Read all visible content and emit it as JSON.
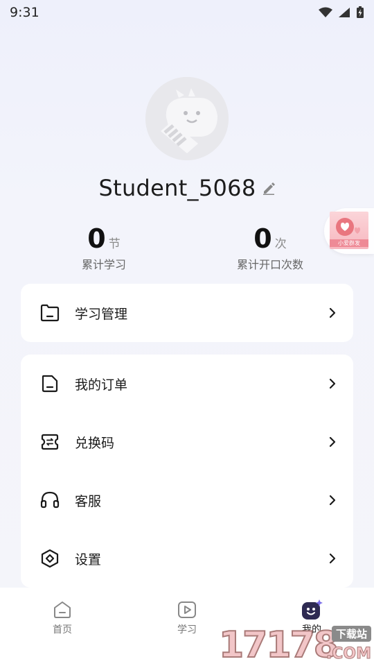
{
  "status_bar": {
    "time": "9:31"
  },
  "profile": {
    "username": "Student_5068"
  },
  "stats": [
    {
      "value": "0",
      "unit": "节",
      "label": "累计学习"
    },
    {
      "value": "0",
      "unit": "次",
      "label": "累计开口次数"
    }
  ],
  "float_badge": {
    "text": "小爱群发"
  },
  "menu_card_1": [
    {
      "label": "学习管理",
      "icon": "folder-icon"
    }
  ],
  "menu_card_2": [
    {
      "label": "我的订单",
      "icon": "document-icon"
    },
    {
      "label": "兑换码",
      "icon": "exchange-ticket-icon"
    },
    {
      "label": "客服",
      "icon": "headset-icon"
    },
    {
      "label": "设置",
      "icon": "settings-diamond-icon"
    }
  ],
  "bottom_nav": [
    {
      "label": "首页",
      "icon": "home-icon",
      "active": false
    },
    {
      "label": "学习",
      "icon": "play-icon",
      "active": false
    },
    {
      "label": "我的",
      "icon": "smiley-face-icon",
      "active": true
    }
  ],
  "watermark": {
    "digits": "17178",
    "top_text": "下载站",
    "suffix": ".COM"
  },
  "colors": {
    "accent": "#3b2e6e",
    "background": "#f4f5fa",
    "card": "#ffffff"
  }
}
